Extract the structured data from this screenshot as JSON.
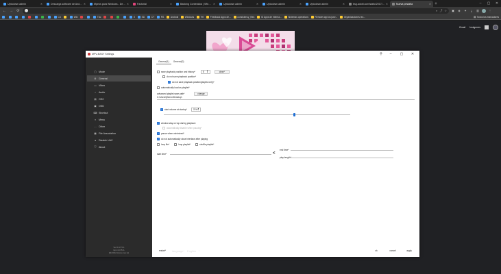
{
  "tabs": [
    {
      "label": "Uptodown admin",
      "color": "#4aa3ff",
      "active": false
    },
    {
      "label": "Descarga software de Androi...",
      "color": "#4aa3ff",
      "active": false
    },
    {
      "label": "Mpeos para Windows - Descar...",
      "color": "#4aa3ff",
      "active": false
    },
    {
      "label": "Factorial",
      "color": "#e0457b",
      "active": false
    },
    {
      "label": "Banking Contenidos | Windo...",
      "color": "#4aa3ff",
      "active": false
    },
    {
      "label": "Uptodown admin",
      "color": "#4aa3ff",
      "active": false
    },
    {
      "label": "Uptodown admin",
      "color": "#4aa3ff",
      "active": false
    },
    {
      "label": "Uptodown admin",
      "color": "#4aa3ff",
      "active": false
    },
    {
      "label": "bsg.adobi.com/static/2017/...",
      "color": "#888888",
      "active": false
    },
    {
      "label": "Nueva pestaña",
      "color": "#888888",
      "active": true
    }
  ],
  "toolbar": {
    "url": "",
    "back": "←",
    "forward": "→",
    "reload": "⟳"
  },
  "bookmarks": [
    {
      "label": "",
      "color": "#4aa3ff"
    },
    {
      "label": "",
      "color": "#4aa3ff"
    },
    {
      "label": "",
      "color": "#4aa3ff"
    },
    {
      "label": "",
      "color": "#4aa3ff"
    },
    {
      "label": "",
      "color": "#e04646"
    },
    {
      "label": "",
      "color": "#4aa3ff"
    },
    {
      "label": "",
      "color": "#3bb54a"
    },
    {
      "label": "",
      "color": "#4aa3ff"
    },
    {
      "label": "C4",
      "color": "#4aa3ff"
    },
    {
      "label": "",
      "color": "#ffcc33"
    },
    {
      "label": "Win",
      "color": "#4aa3ff"
    },
    {
      "label": "",
      "color": "#e04646"
    },
    {
      "label": "",
      "color": "#4aa3ff"
    },
    {
      "label": "Tdc",
      "color": "#4aa3ff"
    },
    {
      "label": "",
      "color": "#e04646"
    },
    {
      "label": "",
      "color": "#e04646"
    },
    {
      "label": "",
      "color": "#3bb54a"
    },
    {
      "label": "",
      "color": "#4aa3ff"
    },
    {
      "label": "X",
      "color": "#4aa3ff"
    },
    {
      "label": "SD",
      "color": "#4aa3ff"
    },
    {
      "label": "CY",
      "color": "#4aa3ff"
    },
    {
      "label": "RS",
      "color": "#4aa3ff"
    },
    {
      "label": "Android",
      "color": "#ffcc33"
    },
    {
      "label": "Windows",
      "color": "#ffcc33"
    },
    {
      "label": "Yet",
      "color": "#ffcc33"
    },
    {
      "label": "Feedback Apps de...",
      "color": "#ffcc33"
    },
    {
      "label": "consistency_files",
      "color": "#ffcc33"
    },
    {
      "label": "IG Apps de interna...",
      "color": "#ffcc33"
    },
    {
      "label": "Sistemas operativos",
      "color": "#ffcc33"
    },
    {
      "label": "Remote app los juez...",
      "color": "#ffcc33"
    },
    {
      "label": "Organizaciones rec...",
      "color": "#ffcc33"
    }
  ],
  "bookmarks_all": "Todos los marcadores",
  "google": {
    "gmail": "Gmail",
    "images": "Imágenes"
  },
  "dialog": {
    "title": "MPV-EASY Settings",
    "sidebar": [
      {
        "label": "Mode",
        "icon": "▢"
      },
      {
        "label": "General",
        "icon": "⚙"
      },
      {
        "label": "Video",
        "icon": "▭"
      },
      {
        "label": "Audio",
        "icon": "♪"
      },
      {
        "label": "OSC",
        "icon": "▤"
      },
      {
        "label": "OSD",
        "icon": "▣"
      },
      {
        "label": "Shortcut",
        "icon": "⌨"
      },
      {
        "label": "Menu",
        "icon": "≡"
      },
      {
        "label": "Other",
        "icon": "…"
      },
      {
        "label": "File Association",
        "icon": "▦"
      },
      {
        "label": "Disable UAC",
        "icon": "●"
      },
      {
        "label": "About",
        "icon": "ⓘ"
      }
    ],
    "version": [
      "Ver:0.17.5.1",
      "mpv:v0.35.0-",
      "[8]:2022 [www.mpv.io]"
    ],
    "tabs": [
      "General(1)",
      "General(2)"
    ],
    "save_playback_position": "save playback position and history*",
    "history_count": "5",
    "clear_button": "clear*",
    "do_not_save_position": "do not save playback position*",
    "do_not_save_playlist": "do not save playback position(playlist only)*",
    "auto_load_playlist": "automatically load as playlist*",
    "advanced_playlist_path_label": "advanced playlist save path*",
    "change_button": "change",
    "playlist_path": "C:\\Users\\jfhernn\\Desktop\\",
    "start_volume_label": "start volume at startup*",
    "start_volume_value": "70%",
    "start_volume_fraction": 0.7,
    "window_stay_top": "window stay on top during playback",
    "auto_disable_pause": "automatically disable when pausing*",
    "pause_minimized": "pause when minimized*",
    "no_auto_close": "do not automatically close interface after playing",
    "loop_file": "loop file*",
    "loop_playlist": "loop playlist*",
    "shuffle_playlist": "shuffle playlist*",
    "start_time_label": "start time*",
    "end_time_label": "end time*",
    "swap_symbol": "<",
    "play_length_label": "play-length*",
    "restart_button": "restart*",
    "language_label": "language*",
    "language_value": "English",
    "ok_button": "ok",
    "cancel_button": "cancel",
    "apply_button": "apply"
  }
}
